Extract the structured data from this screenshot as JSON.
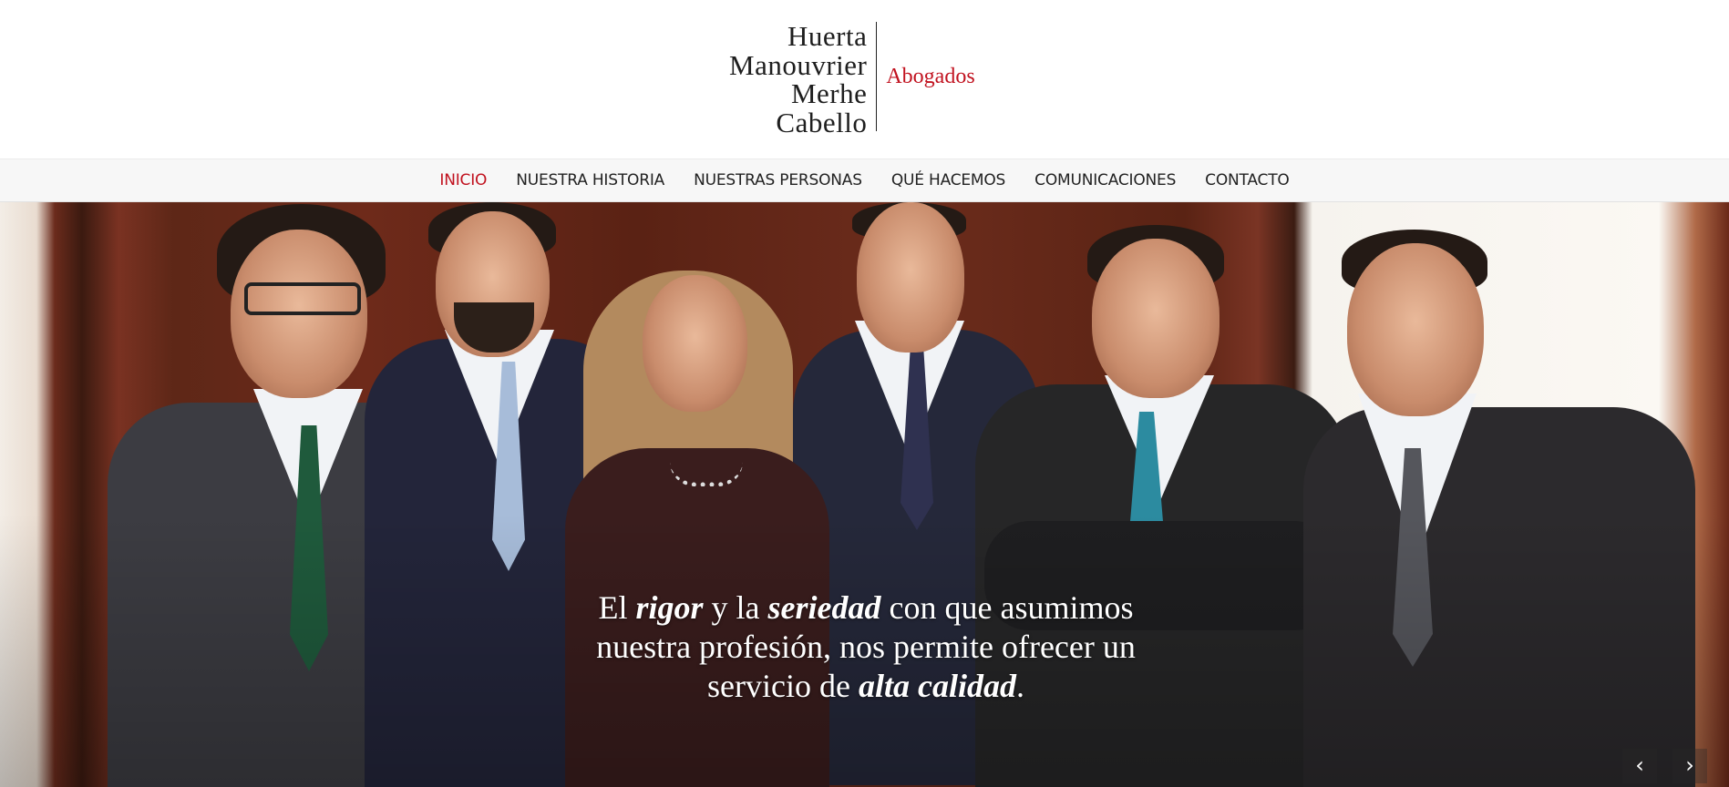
{
  "logo": {
    "names": [
      "Huerta",
      "Manouvrier",
      "Merhe",
      "Cabello"
    ],
    "subtitle": "Abogados"
  },
  "nav": {
    "items": [
      {
        "label": "INICIO",
        "active": true
      },
      {
        "label": "NUESTRA HISTORIA",
        "active": false
      },
      {
        "label": "NUESTRAS PERSONAS",
        "active": false
      },
      {
        "label": "QUÉ HACEMOS",
        "active": false
      },
      {
        "label": "COMUNICACIONES",
        "active": false
      },
      {
        "label": "CONTACTO",
        "active": false
      }
    ]
  },
  "hero": {
    "line1": {
      "a": "El ",
      "b": "rigor",
      "c": " y la ",
      "d": "seriedad",
      "e": " con que asumimos"
    },
    "line2": "nuestra profesión, nos permite ofrecer un",
    "line3": {
      "a": "servicio de ",
      "b": "alta calidad",
      "c": "."
    },
    "prev_icon": "chevron-left-icon",
    "next_icon": "chevron-right-icon"
  },
  "colors": {
    "accent": "#c1121f",
    "nav_bg": "#f7f7f7",
    "text": "#222222"
  }
}
